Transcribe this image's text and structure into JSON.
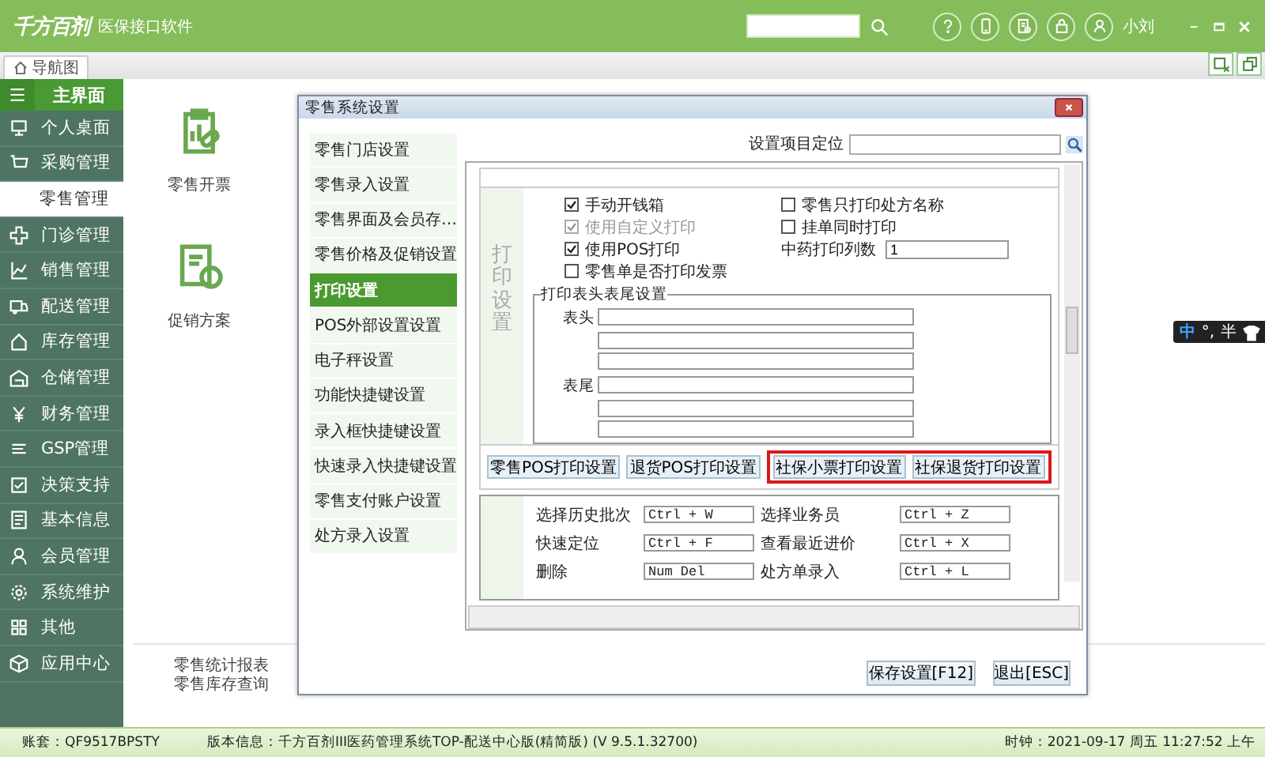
{
  "app": {
    "logo": "千方百剂",
    "product": "医保接口软件",
    "user": "小刘"
  },
  "nav_tab": {
    "label": "导航图",
    "selected": true
  },
  "sidebar": {
    "title": "主界面",
    "items": [
      {
        "label": "个人桌面",
        "selected": false
      },
      {
        "label": "采购管理",
        "selected": false
      },
      {
        "label": "零售管理",
        "selected": true
      },
      {
        "label": "门诊管理",
        "selected": false
      },
      {
        "label": "销售管理",
        "selected": false
      },
      {
        "label": "配送管理",
        "selected": false
      },
      {
        "label": "库存管理",
        "selected": false
      },
      {
        "label": "仓储管理",
        "selected": false
      },
      {
        "label": "财务管理",
        "selected": false
      },
      {
        "label": "GSP管理",
        "selected": false
      },
      {
        "label": "决策支持",
        "selected": false
      },
      {
        "label": "基本信息",
        "selected": false
      },
      {
        "label": "会员管理",
        "selected": false
      },
      {
        "label": "系统维护",
        "selected": false
      },
      {
        "label": "其他",
        "selected": false
      },
      {
        "label": "应用中心",
        "selected": false
      }
    ]
  },
  "workspace": {
    "shortcuts": [
      {
        "label": "零售开票"
      },
      {
        "label": "促销方案"
      }
    ],
    "links": [
      "零售统计报表",
      "零售库存查询"
    ]
  },
  "dialog": {
    "title": "零售系统设置",
    "nav": [
      {
        "label": "零售门店设置",
        "selected": false
      },
      {
        "label": "零售录入设置",
        "selected": false
      },
      {
        "label": "零售界面及会员存…",
        "selected": false
      },
      {
        "label": "零售价格及促销设置",
        "selected": false
      },
      {
        "label": "打印设置",
        "selected": true
      },
      {
        "label": "POS外部设置设置",
        "selected": false
      },
      {
        "label": "电子秤设置",
        "selected": false
      },
      {
        "label": "功能快捷键设置",
        "selected": false
      },
      {
        "label": "录入框快捷键设置",
        "selected": false
      },
      {
        "label": "快速录入快捷键设置",
        "selected": false
      },
      {
        "label": "零售支付账户设置",
        "selected": false
      },
      {
        "label": "处方录入设置",
        "selected": false
      }
    ],
    "locate_label": "设置项目定位",
    "section_label": "打印设置",
    "options_left": [
      {
        "label": "手动开钱箱",
        "checked": true,
        "disabled": false
      },
      {
        "label": "使用自定义打印",
        "checked": true,
        "disabled": true
      },
      {
        "label": "使用POS打印",
        "checked": true,
        "disabled": false
      },
      {
        "label": "零售单是否打印发票",
        "checked": false,
        "disabled": false
      }
    ],
    "options_right": [
      {
        "label": "零售只打印处方名称",
        "checked": false,
        "disabled": false
      },
      {
        "label": "挂单同时打印",
        "checked": false,
        "disabled": false
      }
    ],
    "columns_label": "中药打印列数",
    "columns_value": "1",
    "header_footer": {
      "title": "打印表头表尾设置",
      "header_label": "表头",
      "footer_label": "表尾"
    },
    "print_buttons": [
      {
        "label": "零售POS打印设置",
        "highlighted": false
      },
      {
        "label": "退货POS打印设置",
        "highlighted": false
      },
      {
        "label": "社保小票打印设置",
        "highlighted": true
      },
      {
        "label": "社保退货打印设置",
        "highlighted": true
      }
    ],
    "hotkeys": [
      {
        "label": "选择历史批次",
        "value": "Ctrl + W"
      },
      {
        "label": "选择业务员",
        "value": "Ctrl + Z"
      },
      {
        "label": "快速定位",
        "value": "Ctrl + F"
      },
      {
        "label": "查看最近进价",
        "value": "Ctrl + X"
      },
      {
        "label": "删除",
        "value": "Num Del"
      },
      {
        "label": "处方单录入",
        "value": "Ctrl + L"
      }
    ],
    "buttons": [
      "保存设置[F12]",
      "退出[ESC]"
    ]
  },
  "ime": {
    "mode": "中",
    "punct": "°,",
    "width": "半"
  },
  "status_bar": {
    "account": "账套：QF9517BPSTY",
    "version": "版本信息：千方百剂III医药管理系统TOP-配送中心版(精简版) (V 9.5.1.32700)",
    "clock": "时钟：2021-09-17 周五 11:27:52 上午"
  }
}
